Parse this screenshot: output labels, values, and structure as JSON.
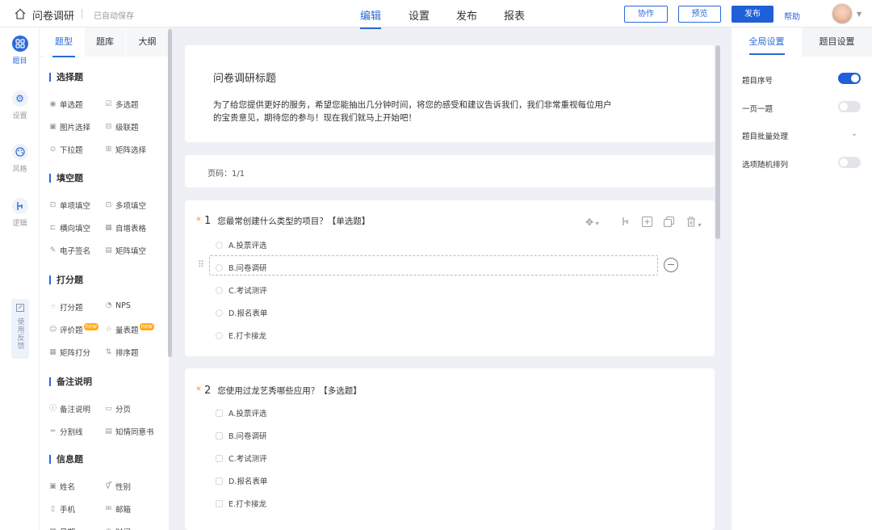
{
  "header": {
    "app_title": "问卷调研",
    "save_status": "已自动保存",
    "nav_tabs": [
      "编辑",
      "设置",
      "发布",
      "报表"
    ],
    "active_tab": "编辑",
    "buttons": {
      "collab": "协作",
      "preview": "预览",
      "publish": "发布",
      "help": "帮助"
    }
  },
  "rail": {
    "items": [
      {
        "label": "题目",
        "icon": "grid-icon",
        "active": true
      },
      {
        "label": "设置",
        "icon": "gear-icon",
        "active": false
      },
      {
        "label": "风格",
        "icon": "palette-icon",
        "active": false
      },
      {
        "label": "逻辑",
        "icon": "logic-icon",
        "active": false
      }
    ],
    "feedback": "使用反馈"
  },
  "palette": {
    "tabs": [
      "题型",
      "题库",
      "大纲"
    ],
    "sections": [
      {
        "title": "选择题",
        "items": [
          {
            "label": "单选题",
            "icon": "radio-icon"
          },
          {
            "label": "多选题",
            "icon": "checkbox-icon"
          },
          {
            "label": "图片选择",
            "icon": "image-icon"
          },
          {
            "label": "级联题",
            "icon": "cascade-icon"
          },
          {
            "label": "下拉题",
            "icon": "dropdown-icon"
          },
          {
            "label": "矩阵选择",
            "icon": "matrix-icon"
          }
        ]
      },
      {
        "title": "填空题",
        "items": [
          {
            "label": "单项填空",
            "icon": "input-icon"
          },
          {
            "label": "多项填空",
            "icon": "multi-input-icon"
          },
          {
            "label": "横向填空",
            "icon": "inline-input-icon"
          },
          {
            "label": "自增表格",
            "icon": "table-icon"
          },
          {
            "label": "电子签名",
            "icon": "pen-icon"
          },
          {
            "label": "矩阵填空",
            "icon": "matrix-input-icon"
          }
        ]
      },
      {
        "title": "打分题",
        "items": [
          {
            "label": "打分题",
            "icon": "thumb-icon"
          },
          {
            "label": "NPS",
            "icon": "nps-icon"
          },
          {
            "label": "评价题",
            "icon": "smile-icon",
            "badge": "new"
          },
          {
            "label": "量表题",
            "icon": "star-icon",
            "badge": "new"
          },
          {
            "label": "矩阵打分",
            "icon": "matrix-score-icon"
          },
          {
            "label": "排序题",
            "icon": "sort-icon"
          }
        ]
      },
      {
        "title": "备注说明",
        "items": [
          {
            "label": "备注说明",
            "icon": "info-icon"
          },
          {
            "label": "分页",
            "icon": "page-icon"
          },
          {
            "label": "分割线",
            "icon": "divider-icon"
          },
          {
            "label": "知情同意书",
            "icon": "consent-icon"
          }
        ]
      },
      {
        "title": "信息题",
        "items": [
          {
            "label": "姓名",
            "icon": "name-icon"
          },
          {
            "label": "性别",
            "icon": "gender-icon"
          },
          {
            "label": "手机",
            "icon": "phone-icon"
          },
          {
            "label": "邮箱",
            "icon": "mail-icon"
          },
          {
            "label": "日期",
            "icon": "calendar-icon"
          },
          {
            "label": "时间",
            "icon": "clock-icon"
          }
        ]
      }
    ]
  },
  "survey": {
    "title": "问卷调研标题",
    "description": "为了给您提供更好的服务，希望您能抽出几分钟时间，将您的感受和建议告诉我们，我们非常重视每位用户的宝贵意见，期待您的参与！现在我们就马上开始吧！",
    "page_label": "页码：1/1",
    "questions": [
      {
        "number": "1",
        "text": "您最常创建什么类型的项目？【单选题】",
        "kind": "radio",
        "options": [
          "A.投票评选",
          "B.问卷调研",
          "C.考试测评",
          "D.报名表单",
          "E.打卡接龙"
        ]
      },
      {
        "number": "2",
        "text": "您使用过龙艺秀哪些应用？【多选题】",
        "kind": "checkbox",
        "options": [
          "A.投票评选",
          "B.问卷调研",
          "C.考试测评",
          "D.报名表单",
          "E.打卡接龙"
        ]
      }
    ]
  },
  "right_panel": {
    "tabs": [
      "全局设置",
      "题目设置"
    ],
    "settings": [
      {
        "label": "题目序号",
        "type": "toggle",
        "on": true
      },
      {
        "label": "一页一题",
        "type": "toggle",
        "on": false
      },
      {
        "label": "题目批量处理",
        "type": "expand"
      },
      {
        "label": "选项随机排列",
        "type": "toggle",
        "on": false
      }
    ]
  },
  "colors": {
    "accent": "#2a6ad9",
    "required_star": "#f29c38",
    "badge_new": "#ffab1f"
  }
}
